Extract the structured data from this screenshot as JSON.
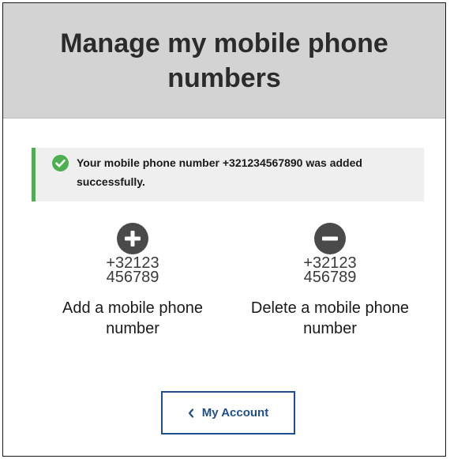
{
  "header": {
    "title": "Manage my mobile phone numbers"
  },
  "alert": {
    "message": "Your mobile phone number +321234567890 was added successfully.",
    "icon": "check-circle-icon",
    "color": "#4caf50"
  },
  "actions": [
    {
      "icon": "plus-circle-icon",
      "number_line1": "+32123",
      "number_line2": "456789",
      "label": "Add a mobile phone number"
    },
    {
      "icon": "minus-circle-icon",
      "number_line1": "+32123",
      "number_line2": "456789",
      "label": "Delete a mobile phone number"
    }
  ],
  "account_button": {
    "icon": "chevron-left-icon",
    "label": "My Account",
    "color": "#1f4e8c"
  }
}
